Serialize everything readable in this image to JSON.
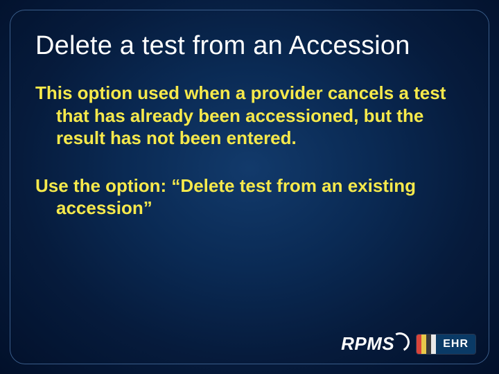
{
  "title": "Delete a test from an Accession",
  "paragraphs": [
    "This option used when a provider cancels a test that has already been accessioned, but the result has not been entered.",
    "Use the option:  “Delete test from an existing accession”"
  ],
  "logo": {
    "rpms": "RPMS",
    "ehr": "EHR"
  }
}
